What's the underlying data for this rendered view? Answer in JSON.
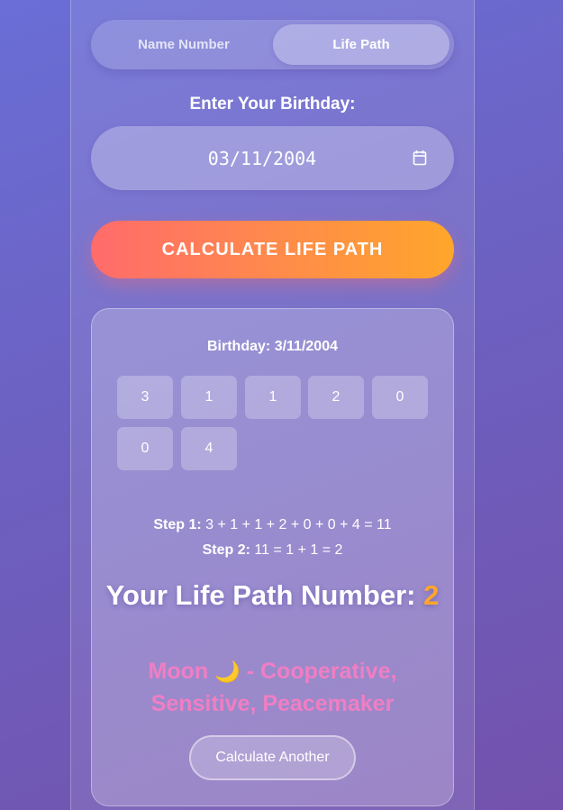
{
  "tabs": [
    {
      "label": "Name Number",
      "active": false
    },
    {
      "label": "Life Path",
      "active": true
    }
  ],
  "birthday_prompt": "Enter Your Birthday:",
  "date_input": {
    "value": "03/11/2004",
    "icon": "calendar-icon"
  },
  "calculate_button": "CALCULATE LIFE PATH",
  "result": {
    "birthday_prefix": "Birthday:",
    "birthday_value": "3/11/2004",
    "digits": [
      "3",
      "1",
      "1",
      "2",
      "0",
      "0",
      "4"
    ],
    "step1_label": "Step 1:",
    "step1_text": "3 + 1 + 1 + 2 + 0 + 0 + 4 = 11",
    "step2_label": "Step 2:",
    "step2_text": "11 = 1 + 1 = 2",
    "title_prefix": "Your Life Path Number:",
    "number": "2",
    "meaning_planet": "Moon",
    "meaning_symbol": "🌙",
    "meaning_text": "- Cooperative, Sensitive, Peacemaker",
    "another_button": "Calculate Another"
  },
  "colors": {
    "accent_orange": "#ffa62b",
    "gradient_start": "#ff6b6b",
    "meaning_pink": "#f07ec4"
  }
}
